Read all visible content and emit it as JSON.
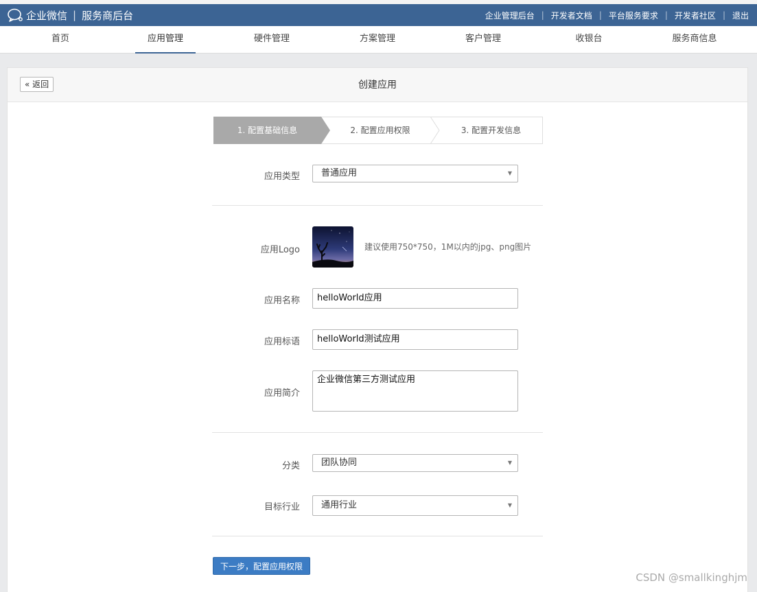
{
  "header": {
    "brand": "企业微信",
    "section": "服务商后台",
    "links": [
      "企业管理后台",
      "开发者文档",
      "平台服务要求",
      "开发者社区",
      "退出"
    ]
  },
  "nav": {
    "items": [
      "首页",
      "应用管理",
      "硬件管理",
      "方案管理",
      "客户管理",
      "收银台",
      "服务商信息"
    ],
    "active": "应用管理"
  },
  "page": {
    "back_label": "返回",
    "title": "创建应用"
  },
  "steps": [
    "1. 配置基础信息",
    "2. 配置应用权限",
    "3. 配置开发信息"
  ],
  "form": {
    "app_type": {
      "label": "应用类型",
      "value": "普通应用"
    },
    "logo": {
      "label": "应用Logo",
      "hint": "建议使用750*750，1M以内的jpg、png图片"
    },
    "name": {
      "label": "应用名称",
      "value": "helloWorld应用"
    },
    "slogan": {
      "label": "应用标语",
      "value": "helloWorld测试应用"
    },
    "intro": {
      "label": "应用简介",
      "value": "企业微信第三方测试应用"
    },
    "category": {
      "label": "分类",
      "value": "团队协同"
    },
    "industry": {
      "label": "目标行业",
      "value": "通用行业"
    },
    "next_label": "下一步，配置应用权限"
  },
  "watermark": "CSDN @smallkinghjm",
  "colors": {
    "header_bg": "#3c6494",
    "active_step_bg": "#a9a9a9",
    "primary_button": "#3c7cc4"
  }
}
